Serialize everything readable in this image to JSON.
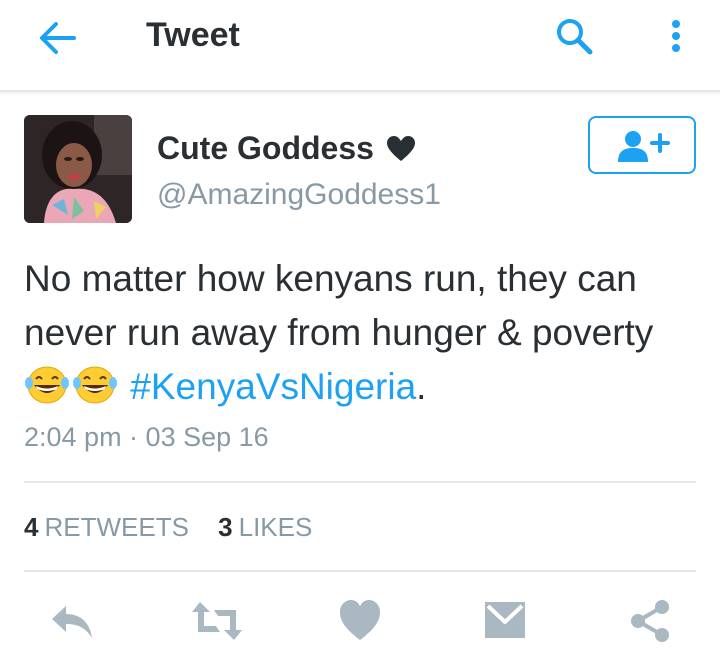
{
  "header": {
    "title": "Tweet",
    "back_icon": "arrow-left-icon",
    "search_icon": "search-icon",
    "more_icon": "more-vertical-icon"
  },
  "tweet": {
    "author_name": "Cute Goddess",
    "author_handle": "@AmazingGoddess1",
    "name_icon": "heart-icon",
    "text_line_1": "No matter how kenyans run, they can never run away from hunger & poverty",
    "emojis": [
      "laughing-tears-emoji",
      "laughing-tears-emoji"
    ],
    "hashtag": "#KenyaVsNigeria",
    "trailing": ".",
    "timestamp": "2:04 pm · 03 Sep 16",
    "follow_icon": "add-user-icon"
  },
  "stats": {
    "retweets_count": "4",
    "retweets_label": "RETWEETS",
    "likes_count": "3",
    "likes_label": "LIKES"
  },
  "actions": [
    "reply-icon",
    "retweet-icon",
    "like-icon",
    "message-icon",
    "share-icon"
  ],
  "colors": {
    "accent": "#1da1f2",
    "text": "#292f33",
    "muted": "#8899a6",
    "divider": "#e1e8ed",
    "action_icon": "#aab8c2"
  }
}
